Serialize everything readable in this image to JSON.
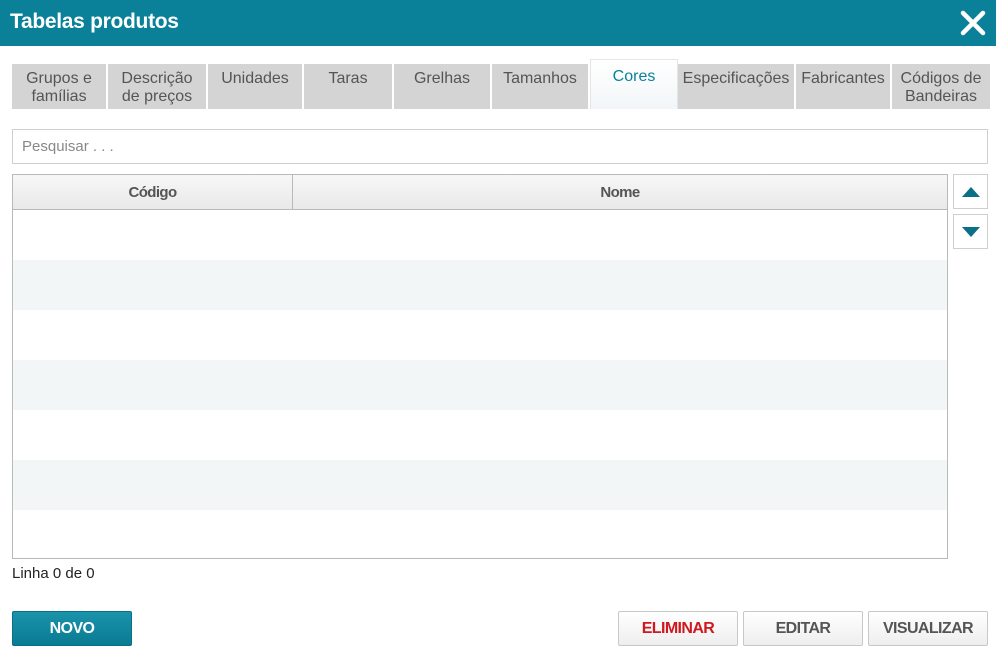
{
  "window": {
    "title": "Tabelas produtos"
  },
  "tabs": [
    {
      "label": "Grupos e\nfamílias"
    },
    {
      "label": "Descrição\nde preços"
    },
    {
      "label": "Unidades"
    },
    {
      "label": "Taras"
    },
    {
      "label": "Grelhas"
    },
    {
      "label": "Tamanhos"
    },
    {
      "label": "Cores",
      "active": true
    },
    {
      "label": "Especificações"
    },
    {
      "label": "Fabricantes"
    },
    {
      "label": "Códigos de\nBandeiras"
    }
  ],
  "search": {
    "placeholder": "Pesquisar . . ."
  },
  "table": {
    "columns": [
      "Código",
      "Nome"
    ],
    "rows": []
  },
  "status": {
    "text": "Linha 0 de 0"
  },
  "buttons": {
    "new": "NOVO",
    "delete": "ELIMINAR",
    "edit": "EDITAR",
    "view": "VISUALIZAR"
  },
  "colors": {
    "header": "#0a8199",
    "active_tab_text": "#0a8199",
    "danger": "#d0181f"
  },
  "icons": {
    "close": "close-icon",
    "scroll_up": "triangle-up-icon",
    "scroll_down": "triangle-down-icon"
  }
}
